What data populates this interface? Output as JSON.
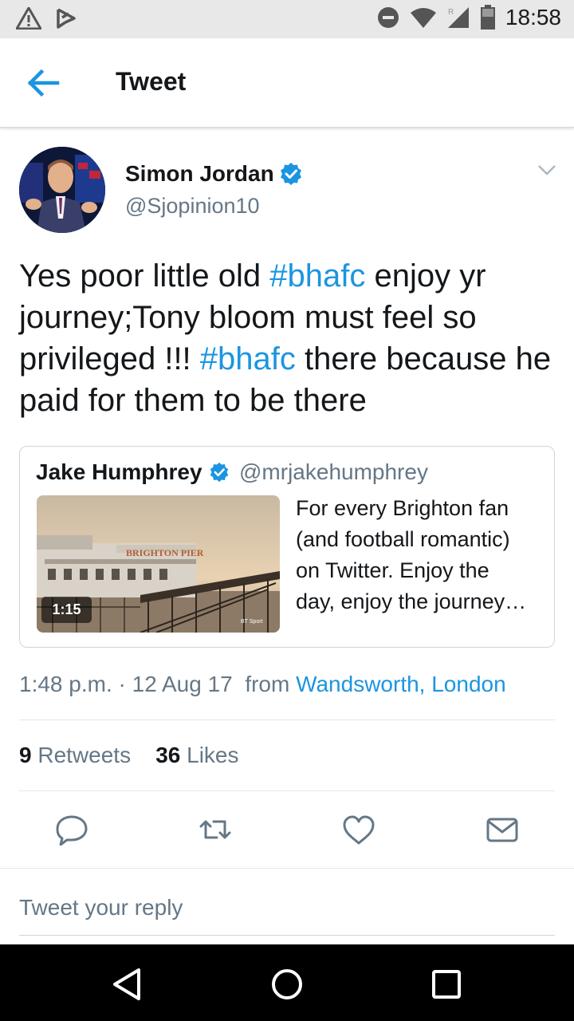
{
  "status_bar": {
    "time": "18:58",
    "icons": [
      "warning-icon",
      "notification-icon",
      "do-not-disturb-icon",
      "wifi-icon",
      "signal-icon",
      "battery-icon"
    ]
  },
  "app_bar": {
    "title": "Tweet",
    "back_icon": "arrow-left-icon"
  },
  "tweet": {
    "author_name": "Simon Jordan",
    "author_handle": "@Sjopinion10",
    "text_parts": {
      "p1": "Yes poor little old ",
      "h1": "#bhafc",
      "p2": " enjoy yr journey;Tony bloom must feel so privileged !!! ",
      "h2": "#bhafc",
      "p3": " there because he paid for them to be there"
    },
    "quoted": {
      "author_name": "Jake Humphrey",
      "author_handle": "@mrjakehumphrey",
      "video_duration": "1:15",
      "text": "For every Brighton fan (and football romantic) on Twitter. Enjoy the day, enjoy the journey…",
      "lines": [
        "For every Brighton fan",
        "(and football romantic)",
        "on Twitter. Enjoy the",
        "day, enjoy the journey…"
      ],
      "image_sign_text": "BRIGHTON PIER",
      "image_watermark": "BT Sport"
    },
    "meta": {
      "time": "1:48 p.m.",
      "separator": "·",
      "date": "12 Aug 17",
      "from_label": "from",
      "location": "Wandsworth, London"
    },
    "stats": {
      "retweets_count": "9",
      "retweets_label": "Retweets",
      "likes_count": "36",
      "likes_label": "Likes"
    },
    "actions": [
      "reply-icon",
      "retweet-icon",
      "like-icon",
      "share-icon"
    ]
  },
  "reply_box": {
    "placeholder": "Tweet your reply"
  },
  "colors": {
    "accent": "#1b95e0",
    "text": "#14171a",
    "muted": "#657786",
    "border": "#e1e8ed",
    "status_bar": "#e8e8e8",
    "nav_bar": "#000000"
  }
}
